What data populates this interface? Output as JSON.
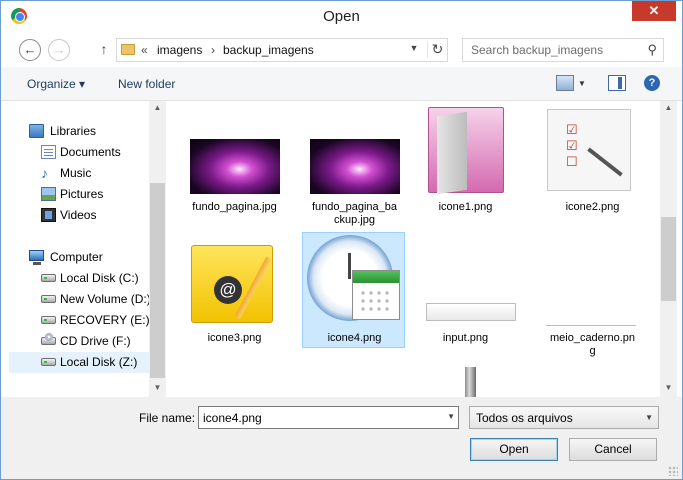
{
  "window": {
    "title": "Open",
    "close_glyph": "✕"
  },
  "nav": {
    "back_glyph": "←",
    "forward_glyph": "→",
    "up_glyph": "↑",
    "breadcrumb": [
      "imagens",
      "backup_imagens"
    ],
    "crumb_sep": "›",
    "overflow_glyph": "«",
    "refresh_glyph": "↻",
    "dropdown_glyph": "▼",
    "search_placeholder": "Search backup_imagens",
    "search_glyph": "⚲"
  },
  "toolbar": {
    "organize_label": "Organize ▾",
    "new_folder_label": "New folder",
    "view_dropdown_glyph": "▼",
    "help_glyph": "?"
  },
  "sidebar": {
    "groups": [
      {
        "label": "Libraries",
        "icon": "libraries-icon"
      },
      {
        "label": "Computer",
        "icon": "computer-icon"
      }
    ],
    "libraries": [
      {
        "label": "Documents",
        "icon": "documents-icon"
      },
      {
        "label": "Music",
        "icon": "music-icon"
      },
      {
        "label": "Pictures",
        "icon": "pictures-icon"
      },
      {
        "label": "Videos",
        "icon": "videos-icon"
      }
    ],
    "drives": [
      {
        "label": "Local Disk (C:)",
        "icon": "drive-icon"
      },
      {
        "label": "New Volume (D:)",
        "icon": "drive-icon"
      },
      {
        "label": "RECOVERY (E:)",
        "icon": "drive-icon"
      },
      {
        "label": "CD Drive (F:)",
        "icon": "cd-drive-icon"
      },
      {
        "label": "Local Disk (Z:)",
        "icon": "drive-icon",
        "selected": true
      }
    ],
    "music_glyph": "♪"
  },
  "files": [
    {
      "name": "fundo_pagina.jpg",
      "thumb": "space-image"
    },
    {
      "name": "fundo_pagina_backup.jpg",
      "name_line1": "fundo_pagina_ba",
      "name_line2": "ckup.jpg",
      "thumb": "space-image"
    },
    {
      "name": "icone1.png",
      "thumb": "pink-folder-image"
    },
    {
      "name": "icone2.png",
      "thumb": "checklist-image"
    },
    {
      "name": "icone3.png",
      "thumb": "email-note-image"
    },
    {
      "name": "icone4.png",
      "thumb": "clock-calendar-image",
      "selected": true
    },
    {
      "name": "input.png",
      "thumb": "input-bar-image"
    },
    {
      "name": "meio_caderno.png",
      "name_line1": "meio_caderno.pn",
      "name_line2": "g",
      "thumb": "line-image"
    },
    {
      "name": "",
      "thumb": "gradient-strip-image"
    }
  ],
  "bottom": {
    "file_name_label": "File name:",
    "file_name_value": "icone4.png",
    "file_type_value": "Todos os arquivos",
    "open_label": "Open",
    "cancel_label": "Cancel",
    "dropdown_glyph": "▼"
  },
  "scroll": {
    "up_glyph": "▲",
    "down_glyph": "▼"
  }
}
